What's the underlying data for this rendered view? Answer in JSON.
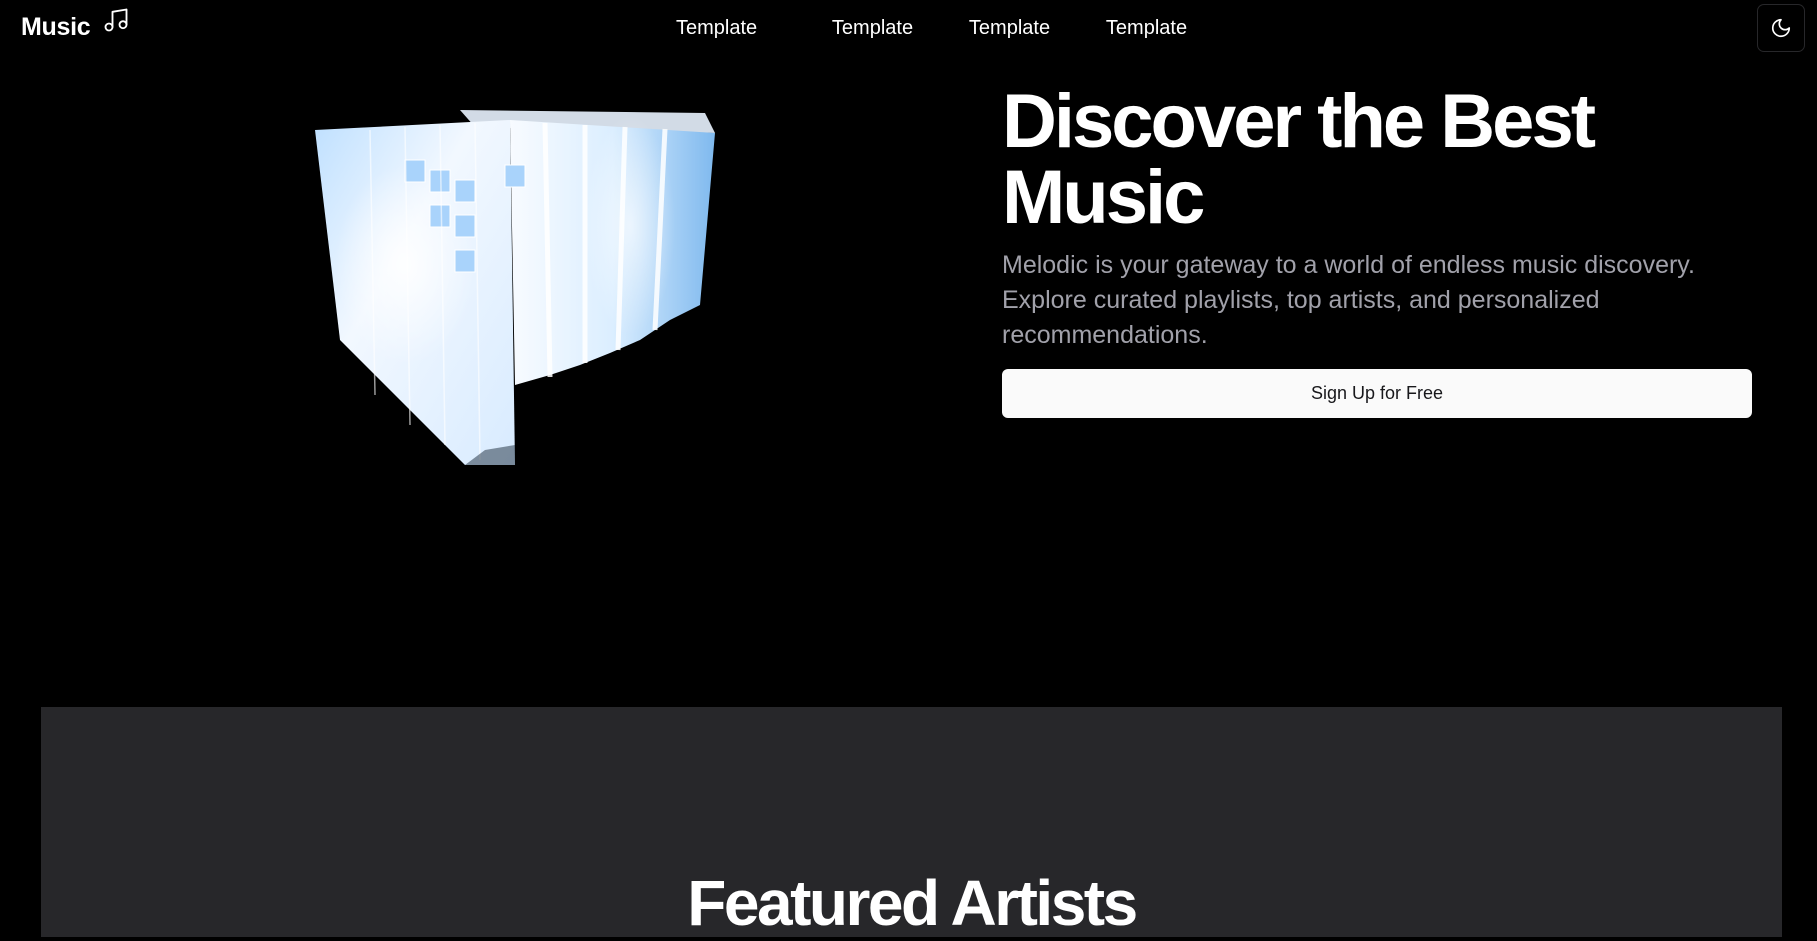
{
  "header": {
    "logo_text": "Music",
    "logo_icon": "music-note-icon",
    "nav": [
      "Template",
      "Template",
      "Template",
      "Template"
    ],
    "theme_toggle_icon": "moon-icon"
  },
  "hero": {
    "title": "Discover the Best Music",
    "subtitle": "Melodic is your gateway to a world of endless music discovery. Explore curated playlists, top artists, and personalized recommendations.",
    "cta_label": "Sign Up for Free",
    "visual": "glowing-cube-visualizer"
  },
  "featured": {
    "title": "Featured Artists"
  },
  "colors": {
    "background": "#000000",
    "panel": "#27272a",
    "muted_text": "#a1a1aa",
    "button_bg": "#fafafa",
    "button_text": "#18181b",
    "cube_glow": "#cfe6ff"
  }
}
